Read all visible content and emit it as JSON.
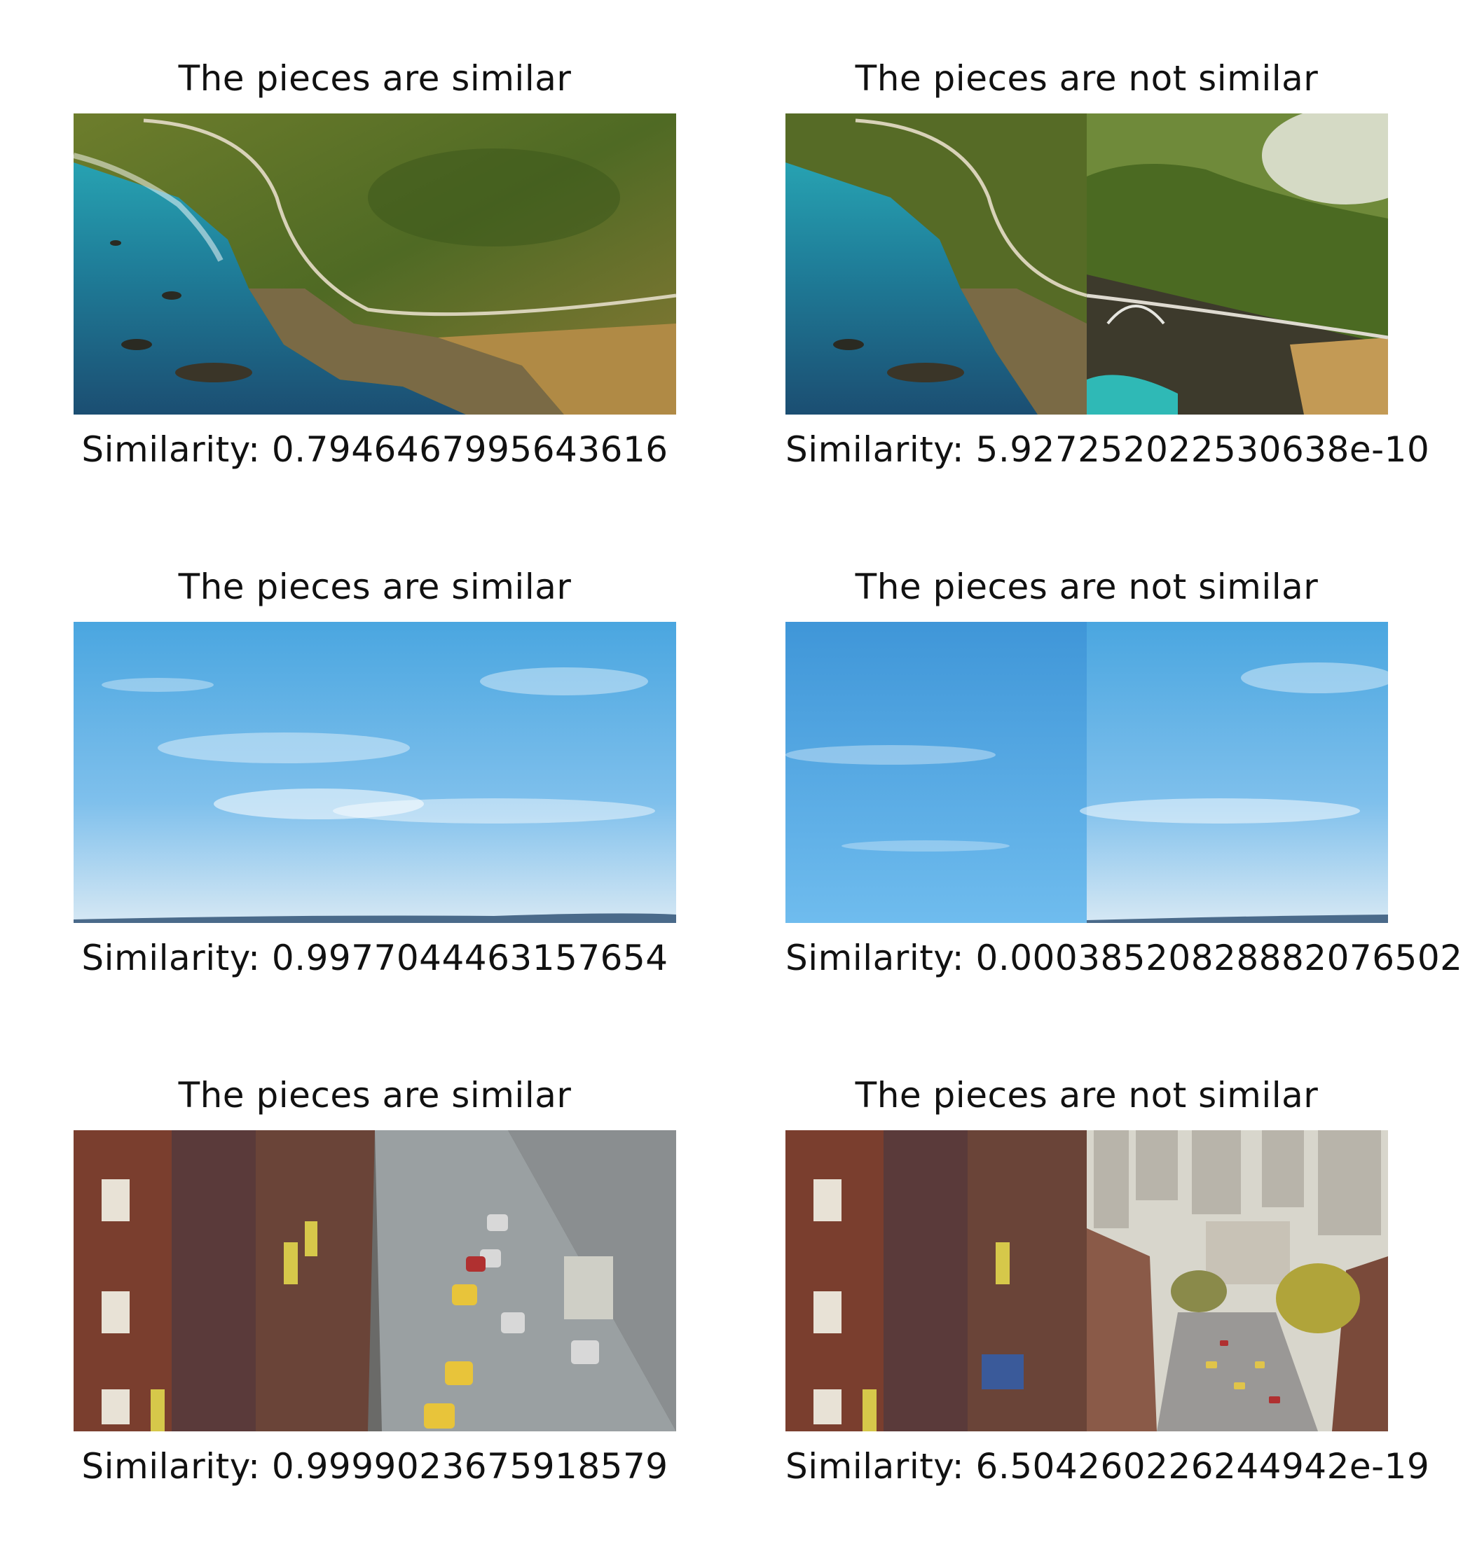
{
  "panels": [
    {
      "title": "The pieces are similar",
      "scene": "coast",
      "caption": "Similarity: 0.7946467995643616"
    },
    {
      "title": "The pieces are not similar",
      "scene": "coast-mismatch",
      "caption": "Similarity: 5.927252022530638e-10"
    },
    {
      "title": "The pieces are similar",
      "scene": "sky",
      "caption": "Similarity: 0.9977044463157654"
    },
    {
      "title": "The pieces are not similar",
      "scene": "sky-mismatch",
      "caption": "Similarity: 0.00038520828882076502"
    },
    {
      "title": "The pieces are similar",
      "scene": "street",
      "caption": "Similarity: 0.9999023675918579"
    },
    {
      "title": "The pieces are not similar",
      "scene": "street-mismatch",
      "caption": "Similarity: 6.504260226244942e-19"
    }
  ]
}
